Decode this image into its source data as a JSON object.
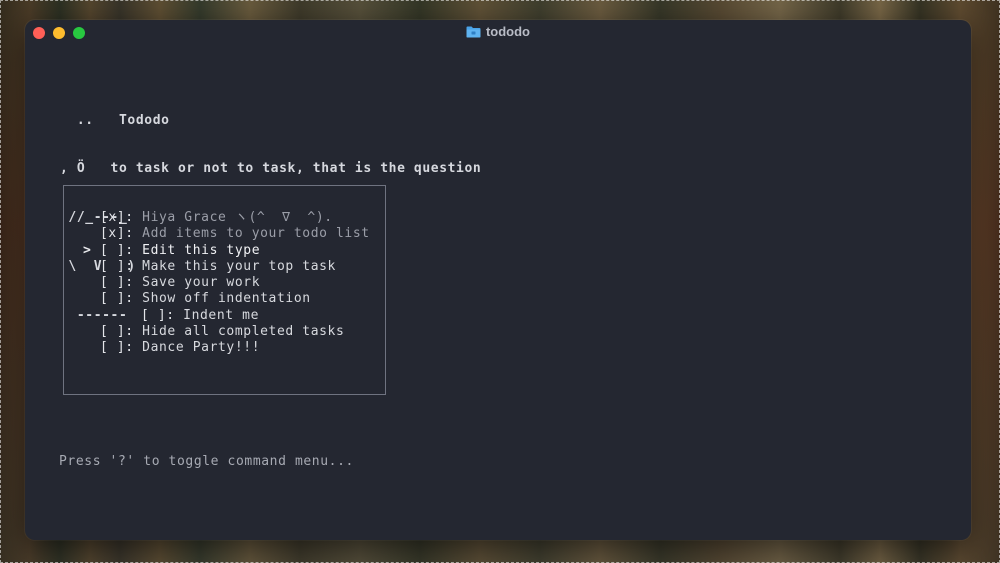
{
  "window": {
    "title": "tododo",
    "icon": "folder-icon"
  },
  "banner": {
    "lines": [
      "  ..   Tododo",
      ", Ö   to task or not to task, that is the question",
      " //_---_",
      " \\  V   )",
      "  ------"
    ]
  },
  "todos": [
    {
      "cursor": "",
      "box": "[x]:",
      "label": "Hiya Grace ヽ(^  ∇  ^).",
      "indent": 0,
      "state": "done"
    },
    {
      "cursor": "",
      "box": "[x]:",
      "label": "Add items to your todo list",
      "indent": 0,
      "state": "done"
    },
    {
      "cursor": ">",
      "box": "[ ]:",
      "label": "Edit this type",
      "indent": 0,
      "state": "active"
    },
    {
      "cursor": "",
      "box": "[ ]:",
      "label": "Make this your top task",
      "indent": 0,
      "state": "pending"
    },
    {
      "cursor": "",
      "box": "[ ]:",
      "label": "Save your work",
      "indent": 0,
      "state": "pending"
    },
    {
      "cursor": "",
      "box": "[ ]:",
      "label": "Show off indentation",
      "indent": 0,
      "state": "pending"
    },
    {
      "cursor": "",
      "box": "[ ]:",
      "label": "Indent me",
      "indent": 1,
      "state": "pending"
    },
    {
      "cursor": "",
      "box": "[ ]:",
      "label": "Hide all completed tasks",
      "indent": 0,
      "state": "pending"
    },
    {
      "cursor": "",
      "box": "[ ]:",
      "label": "Dance Party!!!",
      "indent": 0,
      "state": "pending"
    }
  ],
  "footer": {
    "help_text": "Press '?' to toggle command menu..."
  },
  "colors": {
    "close": "#ff5f57",
    "minimize": "#febc2e",
    "maximize": "#28c840",
    "terminal_bg": "#242731",
    "folder": "#4aa3e8"
  }
}
